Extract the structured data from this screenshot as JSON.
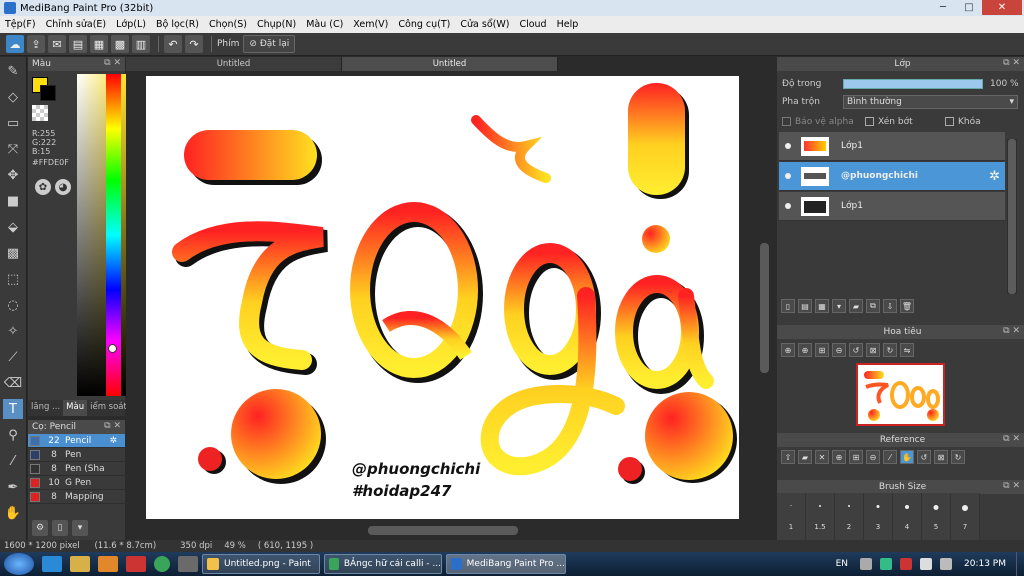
{
  "window": {
    "title": "MediBang Paint Pro (32bit)",
    "minimize": "─",
    "maximize": "□",
    "close": "✕"
  },
  "menu": [
    "Tệp(F)",
    "Chỉnh sửa(E)",
    "Lớp(L)",
    "Bộ lọc(R)",
    "Chọn(S)",
    "Chụp(N)",
    "Màu (C)",
    "Xem(V)",
    "Công cụ(T)",
    "Cửa sổ(W)",
    "Cloud",
    "Help"
  ],
  "toolbar": {
    "label": "Phím",
    "reset": "Đặt lại"
  },
  "color_panel": {
    "title": "Màu",
    "rgb_r": "R:255",
    "rgb_g": "G:222",
    "rgb_b": "B:15",
    "hex": "#FFDE0F",
    "fg_color": "#FFDE0F"
  },
  "panel_tabs": [
    "lăng ...",
    "Màu",
    "iểm soát."
  ],
  "brush_panel": {
    "title": "Cọ: Pencil",
    "items": [
      {
        "size": "22",
        "name": "Pencil",
        "color": "#3c6fb0"
      },
      {
        "size": "8",
        "name": "Pen",
        "color": "#2c3f66"
      },
      {
        "size": "8",
        "name": "Pen (Sha",
        "color": "#333333"
      },
      {
        "size": "10",
        "name": "G Pen",
        "color": "#d22"
      },
      {
        "size": "8",
        "name": "Mapping",
        "color": "#d22"
      }
    ]
  },
  "doc_tabs": [
    "Untitled",
    "Untitled"
  ],
  "canvas": {
    "handle": "@phuongchichi",
    "hashtag": "#hoidap247"
  },
  "layer_panel": {
    "title": "Lớp",
    "opacity_label": "Độ trong",
    "opacity_value": "100 %",
    "opacity_level": 1.0,
    "blend_label": "Pha trộn",
    "blend_value": "Bình thường",
    "protect_alpha": "Bảo vệ alpha",
    "clip": "Xén bớt",
    "lock": "Khóa",
    "layers": [
      {
        "name": "Lớp1",
        "selected": false
      },
      {
        "name": "@phuongchichi",
        "selected": true
      },
      {
        "name": "Lớp1",
        "selected": false
      }
    ]
  },
  "navigator": {
    "title": "Hoa tiêu"
  },
  "reference": {
    "title": "Reference"
  },
  "brush_size": {
    "title": "Brush Size",
    "sizes": [
      "1",
      "1.5",
      "2",
      "3",
      "4",
      "5",
      "7"
    ]
  },
  "status": {
    "dims": "1600 * 1200 pixel",
    "cm": "(11.6 * 8.7cm)",
    "dpi": "350 dpi",
    "zoom": "49 %",
    "coords": "( 610, 1195 )"
  },
  "taskbar": {
    "items": [
      "Untitled.png - Paint",
      "BẢngc hữ cái calli - ...",
      "MediBang Paint Pro ..."
    ],
    "lang": "EN",
    "time": "20:13 PM"
  }
}
